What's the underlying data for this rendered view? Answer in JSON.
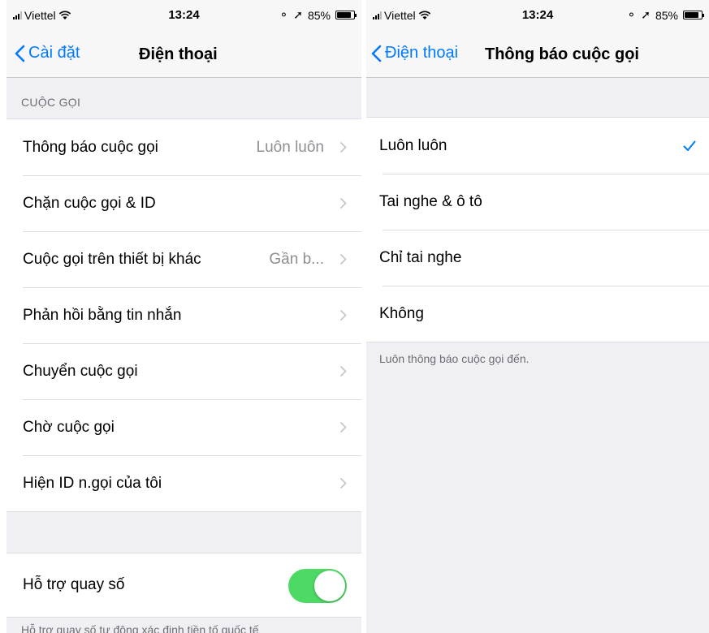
{
  "left_screen": {
    "status_bar": {
      "carrier": "Viettel",
      "time": "13:24",
      "battery_percent": "85%",
      "battery_level": 0.85
    },
    "nav": {
      "back_label": "Cài đặt",
      "title": "Điện thoại"
    },
    "section_header": "CUỘC GỌI",
    "rows": [
      {
        "label": "Thông báo cuộc gọi",
        "value": "Luôn luôn"
      },
      {
        "label": "Chặn cuộc gọi & ID",
        "value": ""
      },
      {
        "label": "Cuộc gọi trên thiết bị khác",
        "value": "Gần b..."
      },
      {
        "label": "Phản hồi bằng tin nhắn",
        "value": ""
      },
      {
        "label": "Chuyển cuộc gọi",
        "value": ""
      },
      {
        "label": "Chờ cuộc gọi",
        "value": ""
      },
      {
        "label": "Hiện ID n.gọi của tôi",
        "value": ""
      }
    ],
    "dial_assist": {
      "label": "Hỗ trợ quay số",
      "enabled": true,
      "toggle_color": "#4cd964"
    },
    "footer": "Hỗ trợ quay số tự động xác định tiền tố quốc tế"
  },
  "right_screen": {
    "status_bar": {
      "carrier": "Viettel",
      "time": "13:24",
      "battery_percent": "85%",
      "battery_level": 0.85
    },
    "nav": {
      "back_label": "Điện thoại",
      "title": "Thông báo cuộc gọi"
    },
    "options": [
      {
        "label": "Luôn luôn",
        "selected": true
      },
      {
        "label": "Tai nghe & ô tô",
        "selected": false
      },
      {
        "label": "Chỉ tai nghe",
        "selected": false
      },
      {
        "label": "Không",
        "selected": false
      }
    ],
    "footer": "Luôn thông báo cuộc gọi đến."
  },
  "colors": {
    "accent": "#007aff",
    "background": "#efeff4",
    "secondary_text": "#8e8e93"
  }
}
